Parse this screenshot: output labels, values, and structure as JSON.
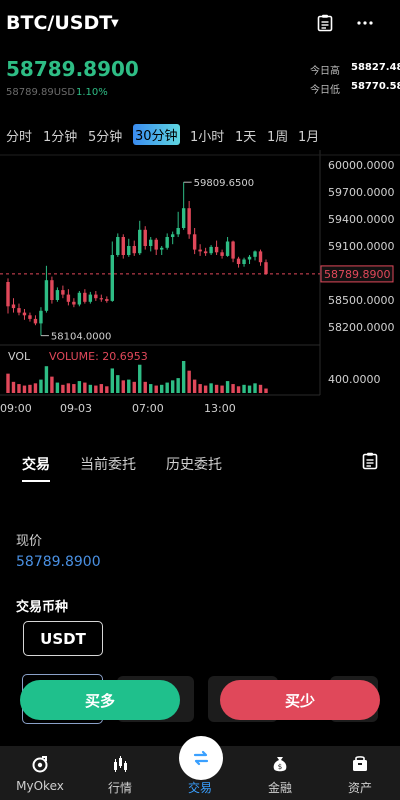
{
  "header": {
    "pair": "BTC/USDT"
  },
  "ticker": {
    "last": "58789.8900",
    "last_usd": "58789.89USD",
    "change_pct": "1.10%",
    "high_label": "今日高",
    "high_value": "58827.48",
    "low_label": "今日低",
    "low_value": "58770.58"
  },
  "intervals": [
    "分时",
    "1分钟",
    "5分钟",
    "30分钟",
    "1小时",
    "1天",
    "1周",
    "1月"
  ],
  "active_interval": "30分钟",
  "chart_data": {
    "type": "candlestick",
    "y_ticks": [
      "60000.0000",
      "59700.0000",
      "59400.0000",
      "59100.0000",
      "58500.0000",
      "58200.0000"
    ],
    "ylim": [
      58000,
      60100
    ],
    "candles": [
      {
        "o": 58700,
        "h": 58740,
        "l": 58350,
        "c": 58430
      },
      {
        "o": 58450,
        "h": 58520,
        "l": 58360,
        "c": 58410
      },
      {
        "o": 58410,
        "h": 58460,
        "l": 58330,
        "c": 58360
      },
      {
        "o": 58360,
        "h": 58400,
        "l": 58280,
        "c": 58330
      },
      {
        "o": 58330,
        "h": 58360,
        "l": 58260,
        "c": 58290
      },
      {
        "o": 58290,
        "h": 58330,
        "l": 58220,
        "c": 58240
      },
      {
        "o": 58240,
        "h": 58420,
        "l": 58104,
        "c": 58380
      },
      {
        "o": 58380,
        "h": 58880,
        "l": 58360,
        "c": 58720
      },
      {
        "o": 58720,
        "h": 58760,
        "l": 58460,
        "c": 58500
      },
      {
        "o": 58500,
        "h": 58640,
        "l": 58480,
        "c": 58610
      },
      {
        "o": 58610,
        "h": 58660,
        "l": 58520,
        "c": 58560
      },
      {
        "o": 58560,
        "h": 58620,
        "l": 58440,
        "c": 58480
      },
      {
        "o": 58480,
        "h": 58520,
        "l": 58420,
        "c": 58450
      },
      {
        "o": 58450,
        "h": 58600,
        "l": 58430,
        "c": 58580
      },
      {
        "o": 58580,
        "h": 58620,
        "l": 58460,
        "c": 58480
      },
      {
        "o": 58480,
        "h": 58590,
        "l": 58460,
        "c": 58560
      },
      {
        "o": 58560,
        "h": 58600,
        "l": 58490,
        "c": 58520
      },
      {
        "o": 58520,
        "h": 58560,
        "l": 58480,
        "c": 58510
      },
      {
        "o": 58510,
        "h": 58540,
        "l": 58470,
        "c": 58490
      },
      {
        "o": 58490,
        "h": 59150,
        "l": 58480,
        "c": 59000
      },
      {
        "o": 59000,
        "h": 59240,
        "l": 58980,
        "c": 59200
      },
      {
        "o": 59200,
        "h": 59230,
        "l": 58960,
        "c": 59000
      },
      {
        "o": 59000,
        "h": 59180,
        "l": 58980,
        "c": 59100
      },
      {
        "o": 59100,
        "h": 59160,
        "l": 58990,
        "c": 59020
      },
      {
        "o": 59020,
        "h": 59380,
        "l": 59000,
        "c": 59280
      },
      {
        "o": 59280,
        "h": 59320,
        "l": 59060,
        "c": 59100
      },
      {
        "o": 59100,
        "h": 59200,
        "l": 59040,
        "c": 59170
      },
      {
        "o": 59170,
        "h": 59190,
        "l": 59000,
        "c": 59060
      },
      {
        "o": 59060,
        "h": 59100,
        "l": 59000,
        "c": 59080
      },
      {
        "o": 59080,
        "h": 59240,
        "l": 59060,
        "c": 59200
      },
      {
        "o": 59200,
        "h": 59260,
        "l": 59120,
        "c": 59230
      },
      {
        "o": 59230,
        "h": 59480,
        "l": 59200,
        "c": 59300
      },
      {
        "o": 59300,
        "h": 59809,
        "l": 59280,
        "c": 59520
      },
      {
        "o": 59520,
        "h": 59600,
        "l": 59180,
        "c": 59230
      },
      {
        "o": 59230,
        "h": 59300,
        "l": 59010,
        "c": 59060
      },
      {
        "o": 59060,
        "h": 59120,
        "l": 58990,
        "c": 59040
      },
      {
        "o": 59040,
        "h": 59080,
        "l": 58990,
        "c": 59020
      },
      {
        "o": 59020,
        "h": 59110,
        "l": 59000,
        "c": 59090
      },
      {
        "o": 59090,
        "h": 59160,
        "l": 59000,
        "c": 59030
      },
      {
        "o": 59030,
        "h": 59060,
        "l": 58960,
        "c": 58990
      },
      {
        "o": 58990,
        "h": 59200,
        "l": 58980,
        "c": 59150
      },
      {
        "o": 59150,
        "h": 59160,
        "l": 58920,
        "c": 58960
      },
      {
        "o": 58960,
        "h": 58980,
        "l": 58860,
        "c": 58900
      },
      {
        "o": 58900,
        "h": 58970,
        "l": 58870,
        "c": 58950
      },
      {
        "o": 58950,
        "h": 59000,
        "l": 58900,
        "c": 58980
      },
      {
        "o": 58980,
        "h": 59050,
        "l": 58940,
        "c": 59040
      },
      {
        "o": 59040,
        "h": 59060,
        "l": 58880,
        "c": 58920
      },
      {
        "o": 58920,
        "h": 58950,
        "l": 58780,
        "c": 58790
      }
    ],
    "high_marker": "59809.6500",
    "low_marker": "58104.0000",
    "current_price": "58789.8900",
    "volume_label": "VOL",
    "volume_value": "VOLUME: 20.6953",
    "volume_tick": "400.0000",
    "volumes": [
      260,
      150,
      120,
      100,
      110,
      130,
      180,
      360,
      220,
      140,
      110,
      130,
      120,
      160,
      140,
      110,
      100,
      120,
      90,
      330,
      240,
      170,
      180,
      150,
      380,
      150,
      120,
      100,
      110,
      140,
      170,
      200,
      430,
      300,
      180,
      120,
      100,
      130,
      110,
      100,
      160,
      120,
      90,
      110,
      100,
      130,
      110,
      60
    ],
    "x_ticks": [
      "09:00",
      "09-03",
      "07:00",
      "13:00"
    ]
  },
  "tabs": [
    "交易",
    "当前委托",
    "历史委托"
  ],
  "form": {
    "current_price_label": "现价",
    "current_price_value": "58789.8900",
    "coin_label": "交易币种",
    "coin_value": "USDT"
  },
  "actions": {
    "buy": "买多",
    "sell": "买少"
  },
  "nav": [
    "MyOkex",
    "行情",
    "交易",
    "金融",
    "资产"
  ],
  "colors": {
    "up": "#2ebd85",
    "down": "#e0485a",
    "accent": "#3aa0ff"
  }
}
